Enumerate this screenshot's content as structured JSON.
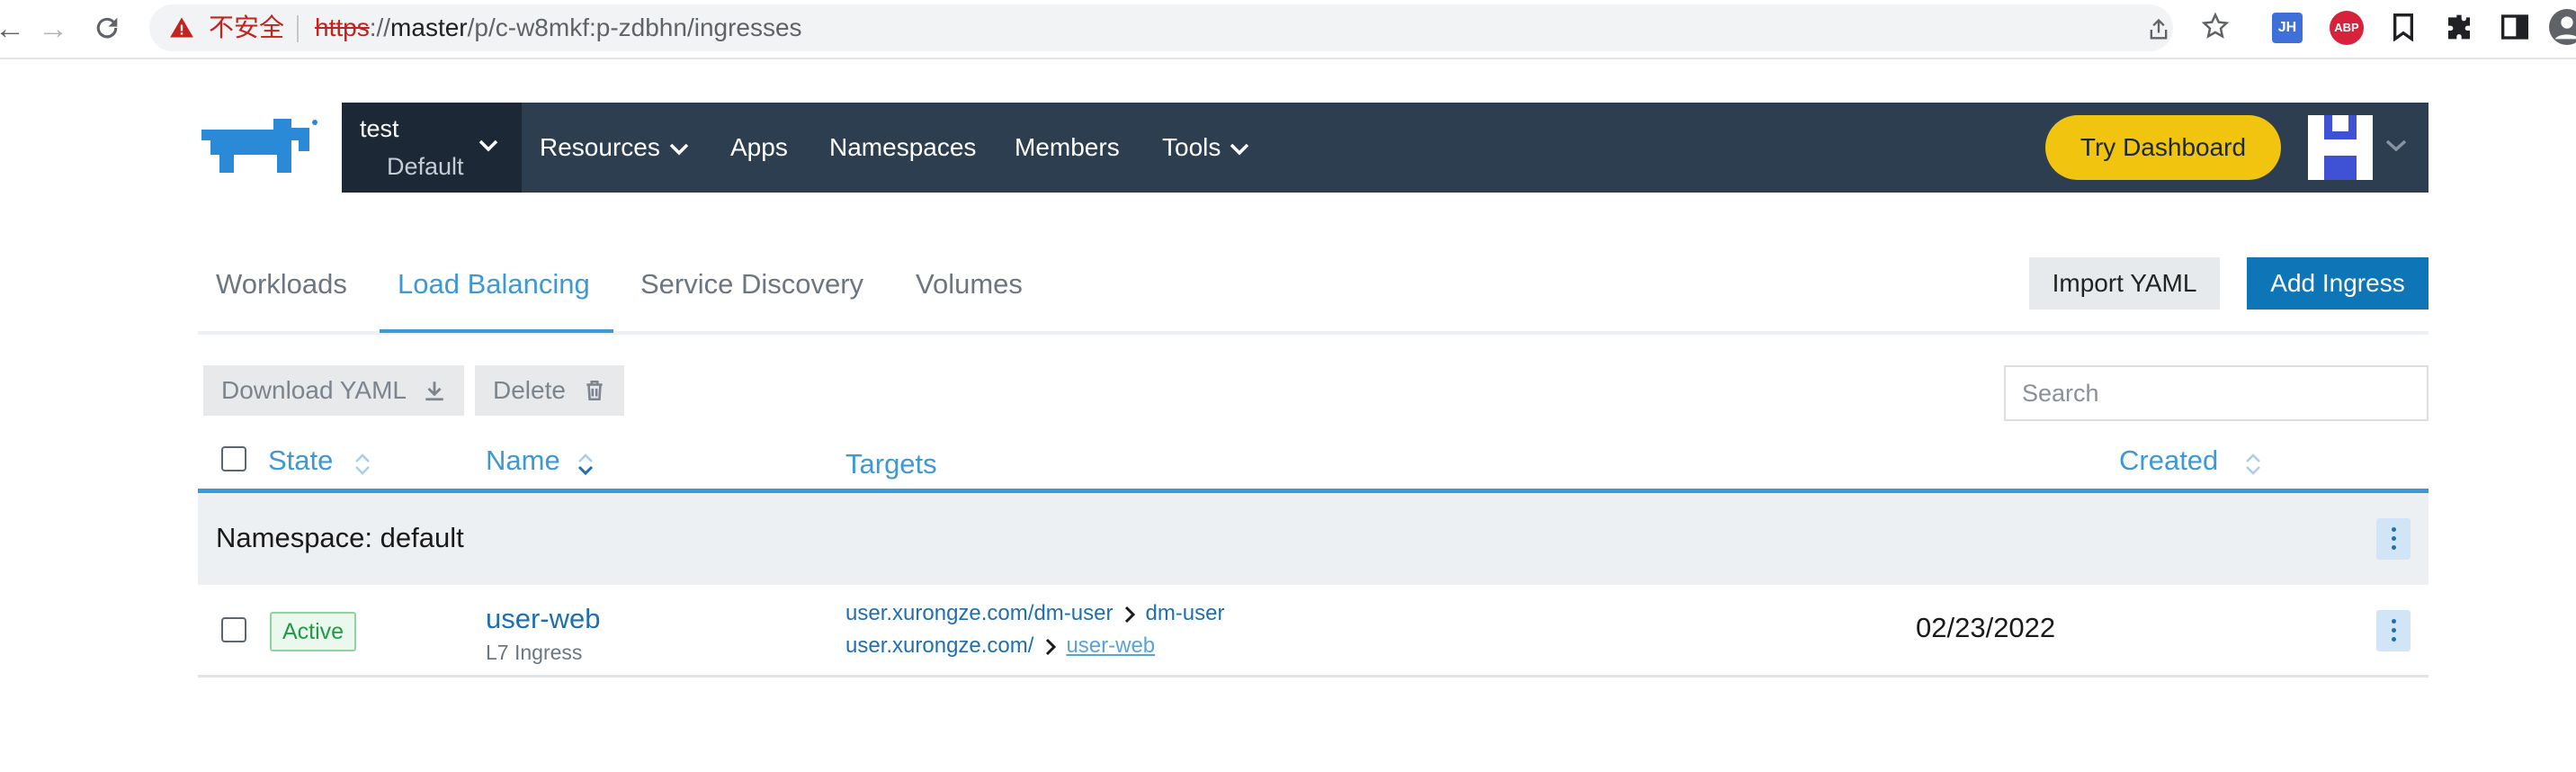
{
  "browser": {
    "security_label": "不安全",
    "url_scheme": "https",
    "url_sep": "://",
    "url_host": "master",
    "url_path": "/p/c-w8mkf:p-zdbhn/ingresses",
    "extensions": [
      {
        "name": "jh-extension",
        "label": "JH",
        "color": "#3f6fd8"
      },
      {
        "name": "adblock-plus",
        "label": "ABP",
        "color": "#d6223a"
      }
    ]
  },
  "header": {
    "cluster": "test",
    "project": "Default",
    "nav": [
      "Resources",
      "Apps",
      "Namespaces",
      "Members",
      "Tools"
    ],
    "try_dashboard": "Try Dashboard"
  },
  "tabs": {
    "items": [
      "Workloads",
      "Load Balancing",
      "Service Discovery",
      "Volumes"
    ],
    "active": "Load Balancing"
  },
  "actions": {
    "import_yaml": "Import YAML",
    "add_ingress": "Add Ingress",
    "download_yaml": "Download YAML",
    "delete": "Delete"
  },
  "search": {
    "placeholder": "Search"
  },
  "table": {
    "columns": {
      "state": "State",
      "name": "Name",
      "targets": "Targets",
      "created": "Created"
    },
    "group_label": "Namespace: default",
    "rows": [
      {
        "state": "Active",
        "name": "user-web",
        "type": "L7 Ingress",
        "targets": [
          {
            "path": "user.xurongze.com/dm-user",
            "service": "dm-user"
          },
          {
            "path": "user.xurongze.com/",
            "service": "user-web"
          }
        ],
        "created": "02/23/2022"
      }
    ]
  },
  "colors": {
    "header_bg": "#2d3e50",
    "accent": "#3d98d3",
    "primary_button": "#0e75b7",
    "dashboard_button": "#f1c40f",
    "active_badge": "#1e9c45"
  }
}
